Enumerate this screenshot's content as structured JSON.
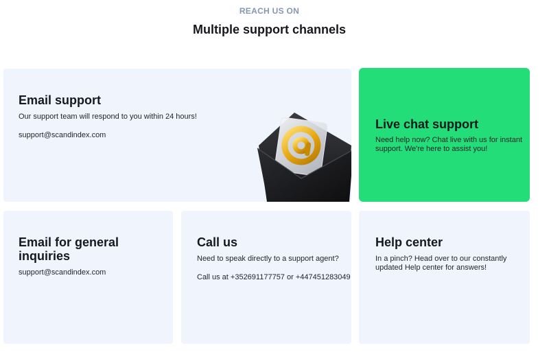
{
  "section": {
    "eyebrow": "REACH US ON",
    "title": "Multiple support channels"
  },
  "cards": {
    "email_support": {
      "title": "Email support",
      "description": "Our support team will respond to you within 24 hours!",
      "email": "support@scandindex.com",
      "illustration_icon": "envelope-at-icon"
    },
    "live_chat": {
      "title": "Live chat support",
      "description": "Need help now? Chat live with us for instant support. We're here to assist you!"
    },
    "general_inquiries": {
      "title": "Email for general inquiries",
      "email": "support@scandindex.com"
    },
    "call_us": {
      "title": "Call us",
      "description": "Need to speak directly to a support agent?",
      "phones": "Call us at +352691177757 or +447451283049"
    },
    "help_center": {
      "title": "Help center",
      "description": "In a pinch? Head over to our constantly updated Help center for answers!"
    }
  },
  "colors": {
    "card_bg": "#f0f4fd",
    "accent_green": "#22dd78",
    "eyebrow": "#8597b0"
  }
}
